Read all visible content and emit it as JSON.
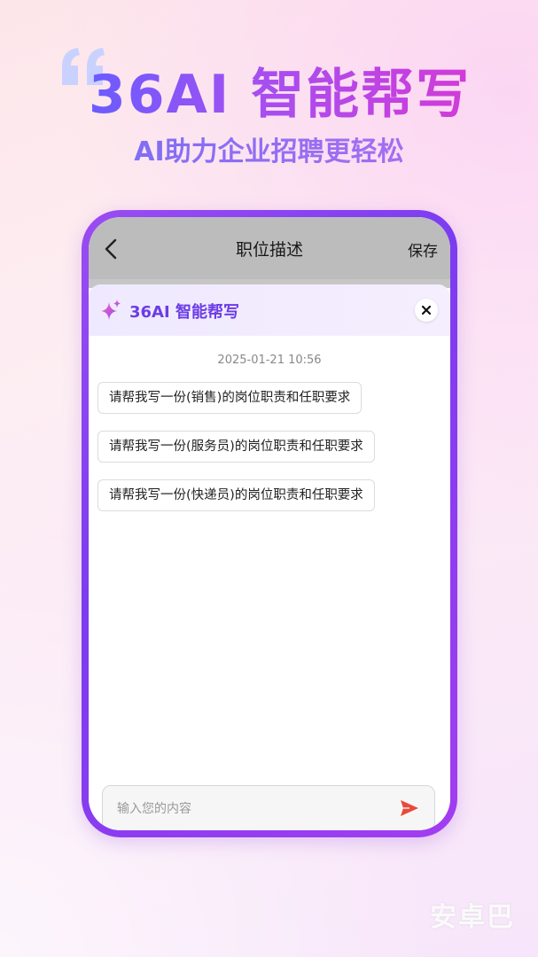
{
  "hero": {
    "title": "36AI 智能帮写",
    "subtitle": "AI助力企业招聘更轻松"
  },
  "topbar": {
    "title": "职位描述",
    "save_label": "保存"
  },
  "assistant": {
    "title": "36AI 智能帮写",
    "timestamp": "2025-01-21 10:56",
    "suggestions": [
      "请帮我写一份(销售)的岗位职责和任职要求",
      "请帮我写一份(服务员)的岗位职责和任职要求",
      "请帮我写一份(快递员)的岗位职责和任职要求"
    ]
  },
  "input": {
    "placeholder": "输入您的内容"
  },
  "watermark": "安卓巴",
  "colors": {
    "accent_purple": "#7b3cf0",
    "send_red": "#e84a3c"
  }
}
